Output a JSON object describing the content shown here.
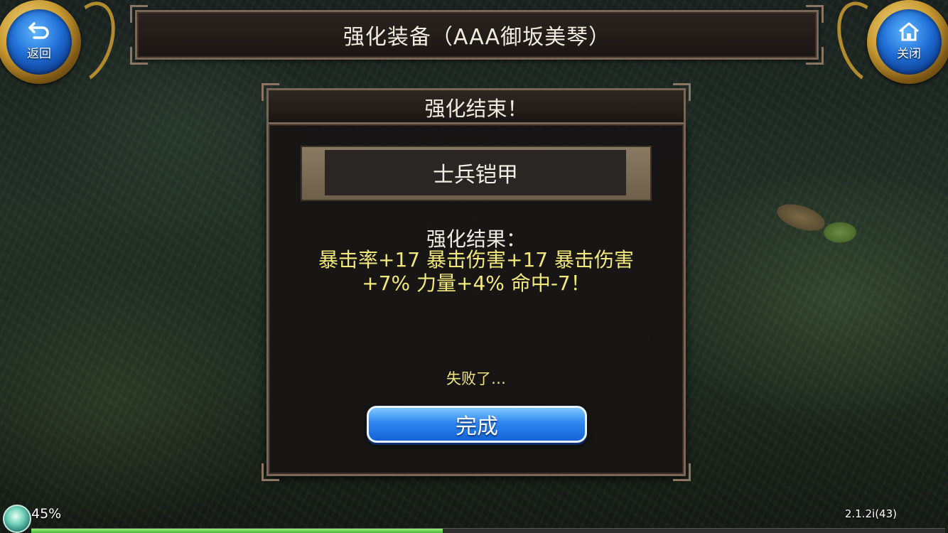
{
  "header": {
    "title": "强化装备（AAA御坂美琴）",
    "back_label": "返回",
    "close_label": "关闭"
  },
  "dialog": {
    "title": "强化结束！",
    "item_name": "士兵铠甲",
    "result_label": "强化结果：",
    "result_text": "暴击率+17 暴击伤害+17 暴击伤害+7% 力量+4% 命中-7！",
    "status_text": "失败了…",
    "done_label": "完成"
  },
  "loading": {
    "percent_text": "45%",
    "progress": 0.45,
    "version": "2.1.2i(43)"
  },
  "colors": {
    "accent_blue": "#2f86f0",
    "result_yellow": "#f3e87a",
    "gold_ring": "#c99a32",
    "progress_green": "#48b83a"
  },
  "icons": {
    "back": "return-arrow-icon",
    "close": "home-icon",
    "loading": "loading-orb-icon"
  }
}
